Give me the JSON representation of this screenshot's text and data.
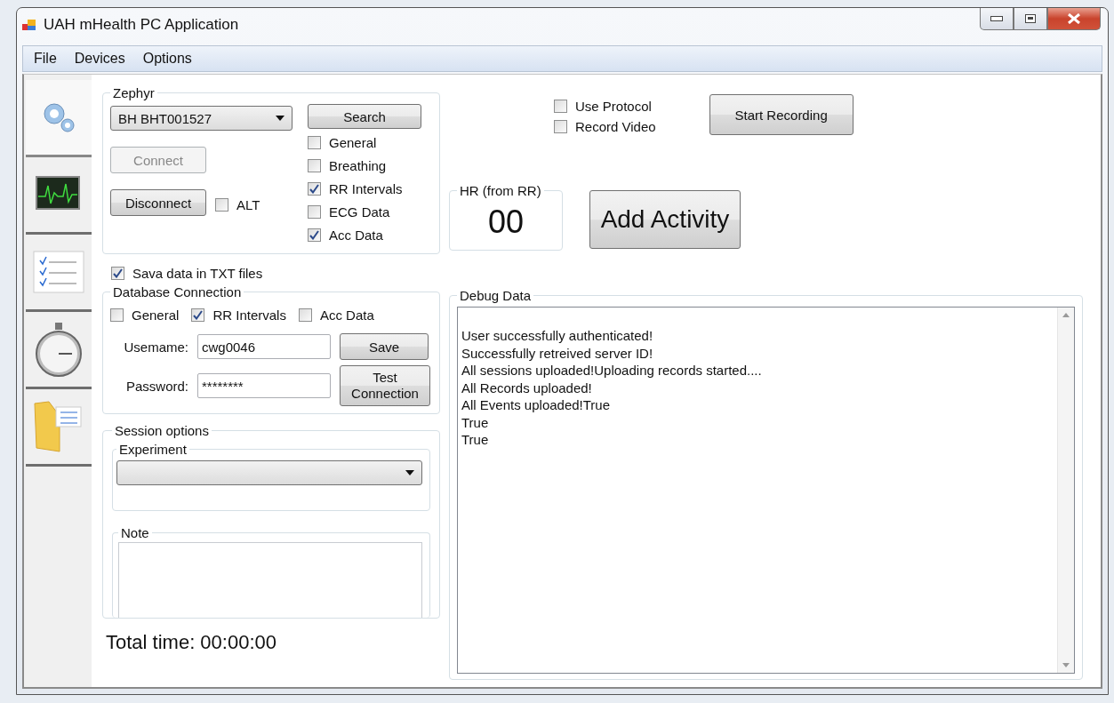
{
  "window": {
    "title": "UAH mHealth PC Application"
  },
  "menu": [
    "File",
    "Devices",
    "Options"
  ],
  "side_tabs": [
    {
      "kind": "gear",
      "selected": true
    },
    {
      "kind": "monitor",
      "selected": false
    },
    {
      "kind": "checklist",
      "selected": false
    },
    {
      "kind": "stopwatch",
      "selected": false
    },
    {
      "kind": "folder",
      "selected": false
    }
  ],
  "zephyr": {
    "title": "Zephyr",
    "device": "BH BHT001527",
    "search": "Search",
    "connect": {
      "label": "Connect",
      "disabled": true
    },
    "disconnect": {
      "label": "Disconnect",
      "disabled": false
    },
    "alt": {
      "label": "ALT",
      "checked": false
    },
    "streams": [
      {
        "label": "General",
        "checked": false
      },
      {
        "label": "Breathing",
        "checked": false
      },
      {
        "label": "RR Intervals",
        "checked": true
      },
      {
        "label": "ECG Data",
        "checked": false
      },
      {
        "label": "Acc Data",
        "checked": true
      }
    ]
  },
  "save_txt": {
    "label": "Sava data in TXT files",
    "checked": true
  },
  "database": {
    "title": "Database Connection",
    "streams": [
      {
        "label": "General",
        "checked": false
      },
      {
        "label": "RR Intervals",
        "checked": true
      },
      {
        "label": "Acc Data",
        "checked": false
      }
    ],
    "username_label": "Usemame:",
    "username": "cwg0046",
    "password_label": "Password:",
    "password": "********",
    "save": "Save",
    "test": "Test Connection"
  },
  "session": {
    "title": "Session options",
    "experiment_title": "Experiment",
    "note_title": "Note"
  },
  "total_time": "Total time: 00:00:00",
  "options": [
    {
      "label": "Use Protocol",
      "checked": false
    },
    {
      "label": "Record Video",
      "checked": false
    }
  ],
  "start_recording": "Start Recording",
  "hr": {
    "title": "HR (from RR)",
    "value": "00"
  },
  "add_activity": "Add Activity",
  "debug": {
    "title": "Debug Data",
    "lines": [
      "User successfully authenticated!",
      "Successfully retreived server ID!",
      "All sessions uploaded!Uploading records started....",
      "All Records uploaded!",
      "All Events uploaded!True",
      "True",
      "True"
    ]
  }
}
